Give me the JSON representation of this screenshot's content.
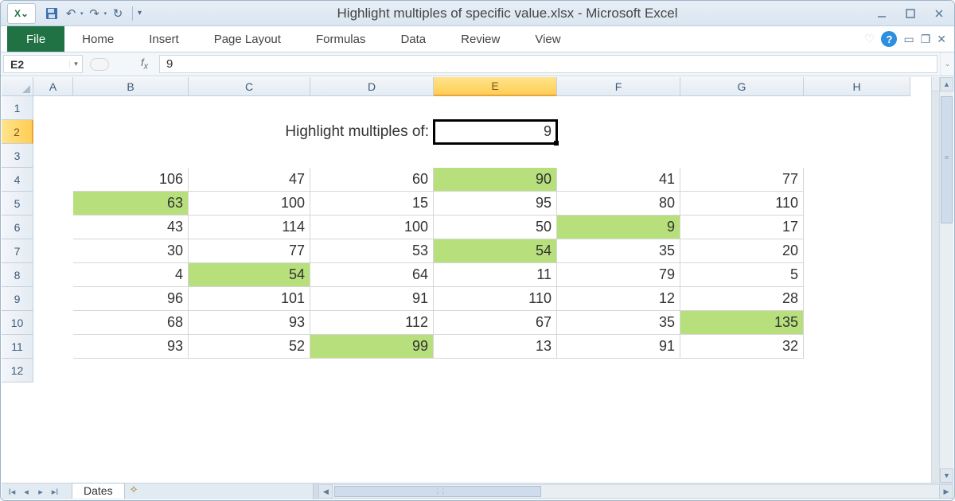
{
  "app_title": "Highlight multiples of specific value.xlsx - Microsoft Excel",
  "ribbon": {
    "file": "File",
    "tabs": [
      "Home",
      "Insert",
      "Page Layout",
      "Formulas",
      "Data",
      "Review",
      "View"
    ]
  },
  "namebox": "E2",
  "formula": "9",
  "active_cell": "E2",
  "prompt_label": "Highlight multiples of:",
  "prompt_value": "9",
  "columns": [
    "A",
    "B",
    "C",
    "D",
    "E",
    "F",
    "G",
    "H"
  ],
  "col_widths": {
    "A": 50,
    "B": 145,
    "C": 153,
    "D": 155,
    "E": 155,
    "F": 155,
    "G": 155,
    "H": 134
  },
  "selected_col": "E",
  "selected_row": 2,
  "data_rows": [
    {
      "r": 4,
      "cells": [
        106,
        47,
        60,
        90,
        41,
        77
      ]
    },
    {
      "r": 5,
      "cells": [
        63,
        100,
        15,
        95,
        80,
        110
      ]
    },
    {
      "r": 6,
      "cells": [
        43,
        114,
        100,
        50,
        9,
        17
      ]
    },
    {
      "r": 7,
      "cells": [
        30,
        77,
        53,
        54,
        35,
        20
      ]
    },
    {
      "r": 8,
      "cells": [
        4,
        54,
        64,
        11,
        79,
        5
      ]
    },
    {
      "r": 9,
      "cells": [
        96,
        101,
        91,
        110,
        12,
        28
      ]
    },
    {
      "r": 10,
      "cells": [
        68,
        93,
        112,
        67,
        35,
        135
      ]
    },
    {
      "r": 11,
      "cells": [
        93,
        52,
        99,
        13,
        91,
        32
      ]
    }
  ],
  "highlight_cells": [
    "E4",
    "B5",
    "F6",
    "E7",
    "C8",
    "G10",
    "D11"
  ],
  "visible_rows": 12,
  "sheet_tab": "Dates"
}
